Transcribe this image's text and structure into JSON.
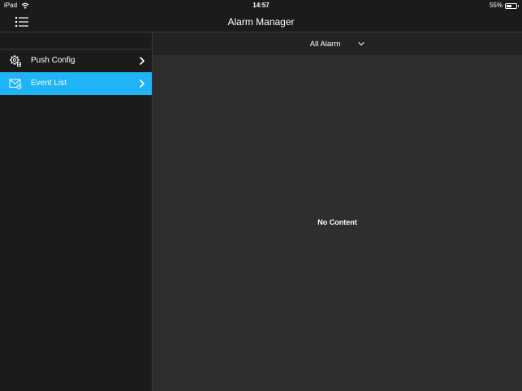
{
  "status_bar": {
    "device": "iPad",
    "time": "14:57",
    "battery_percent": "55%",
    "battery_level": 0.55,
    "wifi_icon": "wifi-icon"
  },
  "nav": {
    "title": "Alarm Manager",
    "menu_icon": "list-menu-icon"
  },
  "sidebar": {
    "items": [
      {
        "label": "Push Config",
        "icon": "gear-config-icon",
        "selected": false
      },
      {
        "label": "Event List",
        "icon": "envelope-event-icon",
        "selected": true
      }
    ]
  },
  "main": {
    "filter": {
      "selected": "All Alarm"
    },
    "empty_message": "No Content"
  },
  "colors": {
    "accent": "#1eb4f5",
    "background": "#1b1b1b",
    "content_background": "#2e2e2e",
    "filter_bar": "#232323"
  }
}
